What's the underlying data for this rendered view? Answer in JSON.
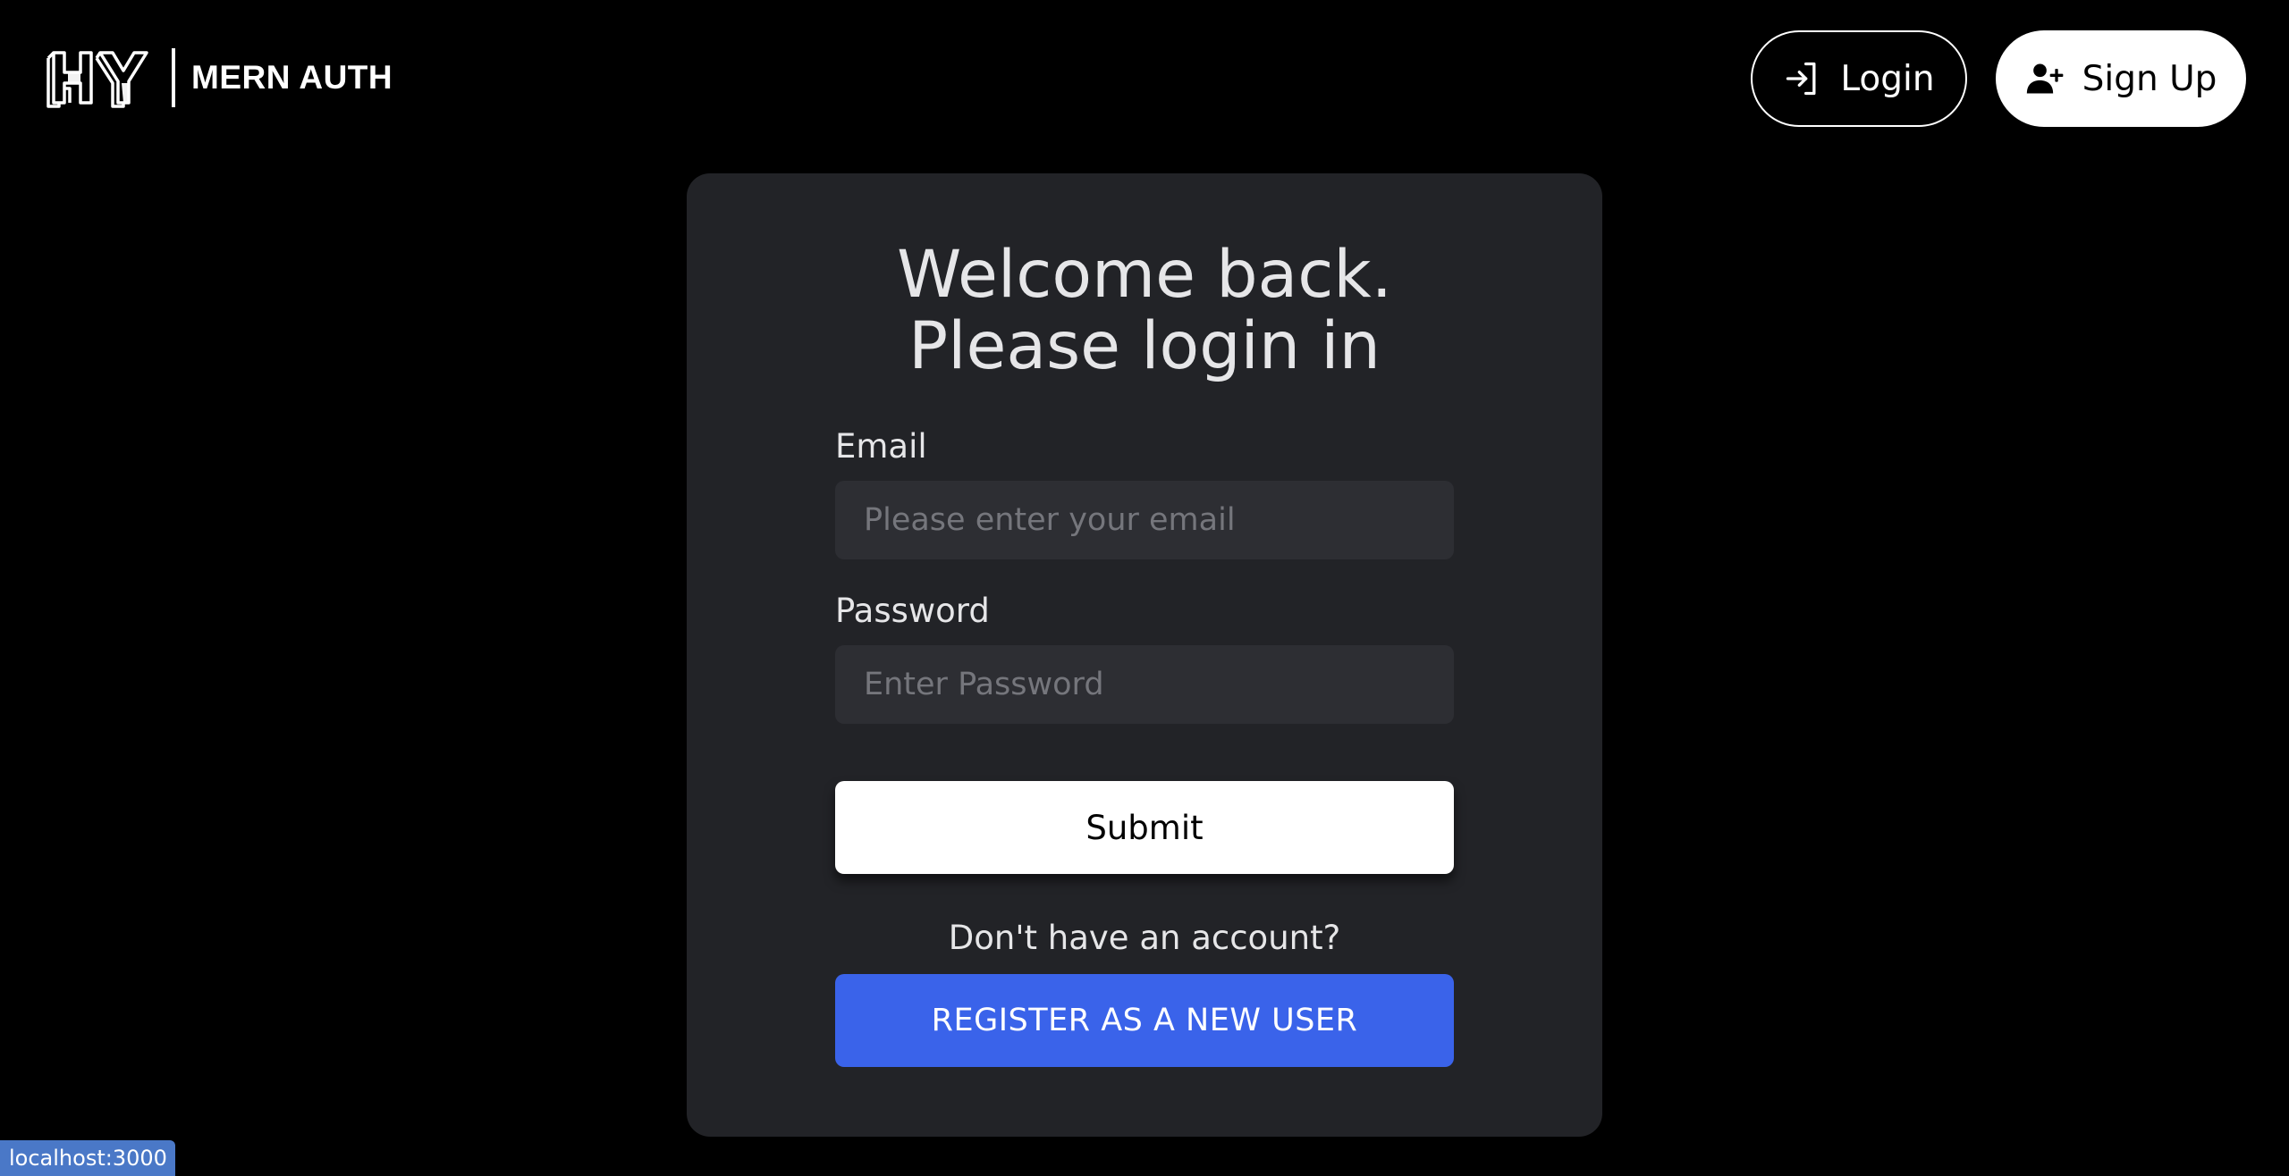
{
  "header": {
    "brand_name": "MERN AUTH",
    "logo_icon": "hy-logo-icon",
    "login_label": "Login",
    "login_icon": "login-arrow-icon",
    "signup_label": "Sign Up",
    "signup_icon": "user-plus-icon"
  },
  "form": {
    "title_line1": "Welcome back.",
    "title_line2": "Please login in",
    "email_label": "Email",
    "email_value": "",
    "email_placeholder": "Please enter your email",
    "password_label": "Password",
    "password_value": "",
    "password_placeholder": "Enter Password",
    "submit_label": "Submit",
    "no_account_text": "Don't have an account?",
    "register_label": "REGISTER AS A NEW USER"
  },
  "status": {
    "url": "localhost:3000"
  },
  "colors": {
    "background": "#000000",
    "card": "#222327",
    "input": "#2d2e33",
    "accent_blue": "#3a63ea",
    "status_bar": "#4a78c7"
  }
}
